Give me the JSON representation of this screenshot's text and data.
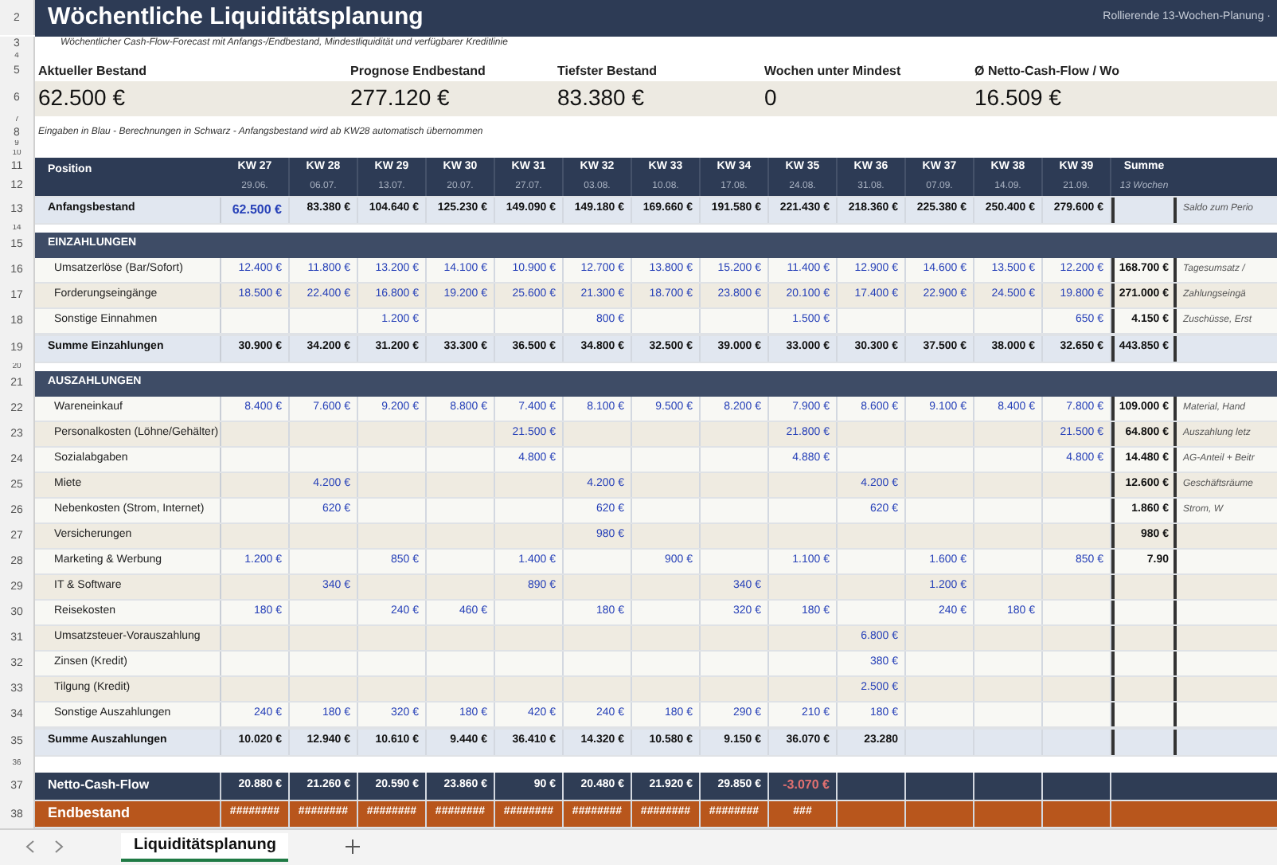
{
  "title": "Wöchentliche Liquiditätsplanung",
  "title_right": "Rollierende 13-Wochen-Planung ·",
  "top_row_numbers": [
    "2",
    "3",
    "4",
    "5",
    "6",
    "7",
    "8",
    "9",
    "10"
  ],
  "subtitle": "Wöchentlicher Cash-Flow-Forecast mit Anfangs-/Endbestand, Mindestliquidität und verfügbarer Kreditlinie",
  "kpis": [
    {
      "label": "Aktueller Bestand",
      "value": "62.500 €"
    },
    {
      "label": "Prognose Endbestand",
      "value": "277.120 €"
    },
    {
      "label": "Tiefster Bestand",
      "value": "83.380 €"
    },
    {
      "label": "Wochen unter Mindest",
      "value": "0"
    },
    {
      "label": "Ø Netto-Cash-Flow / Wo",
      "value": "16.509 €"
    }
  ],
  "note": "Eingaben in Blau - Berechnungen in Schwarz - Anfangsbestand wird ab KW28 automatisch übernommen",
  "header": {
    "nums": [
      "11",
      "12"
    ],
    "position": "Position",
    "summe": "Summe",
    "summe_sub": "13 Wochen",
    "weeks": [
      {
        "kw": "KW 27",
        "date": "29.06."
      },
      {
        "kw": "KW 28",
        "date": "06.07."
      },
      {
        "kw": "KW 29",
        "date": "13.07."
      },
      {
        "kw": "KW 30",
        "date": "20.07."
      },
      {
        "kw": "KW 31",
        "date": "27.07."
      },
      {
        "kw": "KW 32",
        "date": "03.08."
      },
      {
        "kw": "KW 33",
        "date": "10.08."
      },
      {
        "kw": "KW 34",
        "date": "17.08."
      },
      {
        "kw": "KW 35",
        "date": "24.08."
      },
      {
        "kw": "KW 36",
        "date": "31.08."
      },
      {
        "kw": "KW 37",
        "date": "07.09."
      },
      {
        "kw": "KW 38",
        "date": "14.09."
      },
      {
        "kw": "KW 39",
        "date": "21.09."
      }
    ]
  },
  "rows": [
    {
      "kind": "start",
      "num": "13",
      "label": "Anfangsbestand",
      "values": [
        {
          "text": "62.500 €",
          "color": "#2741b8"
        },
        "83.380 €",
        "104.640 €",
        "125.230 €",
        "149.090 €",
        "149.180 €",
        "169.660 €",
        "191.580 €",
        "221.430 €",
        "218.360 €",
        "225.380 €",
        "250.400 €",
        "279.600 €"
      ],
      "note": "Saldo zum Perio"
    },
    {
      "kind": "spacer",
      "num": "14"
    },
    {
      "kind": "section",
      "num": "15",
      "label": "EINZAHLUNGEN"
    },
    {
      "kind": "input",
      "num": "16",
      "label": "Umsatzerlöse (Bar/Sofort)",
      "values": [
        "12.400 €",
        "11.800 €",
        "13.200 €",
        "14.100 €",
        "10.900 €",
        "12.700 €",
        "13.800 €",
        "15.200 €",
        "11.400 €",
        "12.900 €",
        "14.600 €",
        "13.500 €",
        "12.200 €"
      ],
      "sum": "168.700 €",
      "note": "Tagesumsatz /"
    },
    {
      "kind": "input",
      "num": "17",
      "label": "Forderungseingänge",
      "values": [
        "18.500 €",
        "22.400 €",
        "16.800 €",
        "19.200 €",
        "25.600 €",
        "21.300 €",
        "18.700 €",
        "23.800 €",
        "20.100 €",
        "17.400 €",
        "22.900 €",
        "24.500 €",
        "19.800 €"
      ],
      "sum": "271.000 €",
      "note": "Zahlungseingä"
    },
    {
      "kind": "input",
      "num": "18",
      "label": "Sonstige Einnahmen",
      "values": [
        {
          "kind": "empty"
        },
        {
          "kind": "empty"
        },
        "1.200 €",
        {
          "kind": "empty"
        },
        {
          "kind": "empty"
        },
        "800 €",
        {
          "kind": "empty"
        },
        {
          "kind": "empty"
        },
        "1.500 €",
        {
          "kind": "empty"
        },
        {
          "kind": "empty"
        },
        {
          "kind": "empty"
        },
        "650 €"
      ],
      "sum": "4.150 €",
      "note": "Zuschüsse, Erst"
    },
    {
      "kind": "total",
      "num": "19",
      "label": "Summe Einzahlungen",
      "values": [
        "30.900 €",
        "34.200 €",
        "31.200 €",
        "33.300 €",
        "36.500 €",
        "34.800 €",
        "32.500 €",
        "39.000 €",
        "33.000 €",
        "30.300 €",
        "37.500 €",
        "38.000 €",
        "32.650 €"
      ],
      "sum": "443.850 €"
    },
    {
      "kind": "spacer",
      "num": "20"
    },
    {
      "kind": "section",
      "num": "21",
      "label": "AUSZAHLUNGEN"
    },
    {
      "kind": "input",
      "num": "22",
      "label": "Wareneinkauf",
      "values": [
        "8.400 €",
        "7.600 €",
        "9.200 €",
        "8.800 €",
        "7.400 €",
        "8.100 €",
        "9.500 €",
        "8.200 €",
        "7.900 €",
        "8.600 €",
        "9.100 €",
        "8.400 €",
        "7.800 €"
      ],
      "sum": "109.000 €",
      "note": "Material, Hand"
    },
    {
      "kind": "input",
      "num": "23",
      "label": "Personalkosten (Löhne/Gehälter)",
      "values": [
        {
          "kind": "empty"
        },
        {
          "kind": "empty"
        },
        {
          "kind": "empty"
        },
        {
          "kind": "empty"
        },
        "21.500 €",
        {
          "kind": "empty"
        },
        {
          "kind": "empty"
        },
        {
          "kind": "empty"
        },
        "21.800 €",
        {
          "kind": "empty"
        },
        {
          "kind": "empty"
        },
        {
          "kind": "empty"
        },
        "21.500 €"
      ],
      "sum": "64.800 €",
      "note": "Auszahlung letz"
    },
    {
      "kind": "input",
      "num": "24",
      "label": "Sozialabgaben",
      "values": [
        {
          "kind": "empty"
        },
        {
          "kind": "empty"
        },
        {
          "kind": "empty"
        },
        {
          "kind": "empty"
        },
        "4.800 €",
        {
          "kind": "empty"
        },
        {
          "kind": "empty"
        },
        {
          "kind": "empty"
        },
        "4.880 €",
        {
          "kind": "empty"
        },
        {
          "kind": "empty"
        },
        {
          "kind": "empty"
        },
        "4.800 €"
      ],
      "sum": "14.480 €",
      "note": "AG-Anteil + Beitr"
    },
    {
      "kind": "input",
      "num": "25",
      "label": "Miete",
      "values": [
        {
          "kind": "empty"
        },
        "4.200 €",
        {
          "kind": "empty"
        },
        {
          "kind": "empty"
        },
        {
          "kind": "empty"
        },
        "4.200 €",
        {
          "kind": "empty"
        },
        {
          "kind": "empty"
        },
        {
          "kind": "empty"
        },
        "4.200 €",
        {
          "kind": "empty"
        },
        {
          "kind": "empty"
        },
        {
          "kind": "empty"
        }
      ],
      "sum": "12.600 €",
      "note": "Geschäftsräume"
    },
    {
      "kind": "input",
      "num": "26",
      "label": "Nebenkosten (Strom, Internet)",
      "values": [
        {
          "kind": "empty"
        },
        "620 €",
        {
          "kind": "empty"
        },
        {
          "kind": "empty"
        },
        {
          "kind": "empty"
        },
        "620 €",
        {
          "kind": "empty"
        },
        {
          "kind": "empty"
        },
        {
          "kind": "empty"
        },
        "620 €",
        {
          "kind": "empty"
        },
        {
          "kind": "empty"
        },
        {
          "kind": "empty"
        }
      ],
      "sum": "1.860 €",
      "note": "Strom, W"
    },
    {
      "kind": "input",
      "num": "27",
      "label": "Versicherungen",
      "values": [
        {
          "kind": "empty"
        },
        {
          "kind": "empty"
        },
        {
          "kind": "empty"
        },
        {
          "kind": "empty"
        },
        {
          "kind": "empty"
        },
        "980 €",
        {
          "kind": "empty"
        },
        {
          "kind": "empty"
        },
        {
          "kind": "empty"
        },
        {
          "kind": "empty"
        },
        {
          "kind": "empty"
        },
        {
          "kind": "empty"
        },
        {
          "kind": "empty"
        }
      ],
      "sum": "980 €"
    },
    {
      "kind": "input",
      "num": "28",
      "label": "Marketing & Werbung",
      "values": [
        "1.200 €",
        {
          "kind": "empty"
        },
        "850 €",
        {
          "kind": "empty"
        },
        "1.400 €",
        {
          "kind": "empty"
        },
        "900 €",
        {
          "kind": "empty"
        },
        "1.100 €",
        {
          "kind": "empty"
        },
        "1.600 €",
        {
          "kind": "empty"
        },
        "850 €"
      ],
      "sum": "7.90"
    },
    {
      "kind": "input",
      "num": "29",
      "label": "IT & Software",
      "values": [
        {
          "kind": "empty"
        },
        "340 €",
        {
          "kind": "empty"
        },
        {
          "kind": "empty"
        },
        "890 €",
        {
          "kind": "empty"
        },
        {
          "kind": "empty"
        },
        "340 €",
        {
          "kind": "empty"
        },
        {
          "kind": "empty"
        },
        "1.200 €",
        {
          "kind": "empty"
        },
        {
          "kind": "empty"
        }
      ]
    },
    {
      "kind": "input",
      "num": "30",
      "label": "Reisekosten",
      "values": [
        "180 €",
        {
          "kind": "empty"
        },
        "240 €",
        "460 €",
        {
          "kind": "empty"
        },
        "180 €",
        {
          "kind": "empty"
        },
        "320 €",
        "180 €",
        {
          "kind": "empty"
        },
        "240 €",
        "180 €",
        {
          "kind": "empty"
        }
      ]
    },
    {
      "kind": "input",
      "num": "31",
      "label": "Umsatzsteuer-Vorauszahlung",
      "values": [
        {
          "kind": "empty"
        },
        {
          "kind": "empty"
        },
        {
          "kind": "empty"
        },
        {
          "kind": "empty"
        },
        {
          "kind": "empty"
        },
        {
          "kind": "empty"
        },
        {
          "kind": "empty"
        },
        {
          "kind": "empty"
        },
        {
          "kind": "empty"
        },
        "6.800 €",
        {
          "kind": "empty"
        },
        {
          "kind": "empty"
        },
        {
          "kind": "empty"
        }
      ]
    },
    {
      "kind": "input",
      "num": "32",
      "label": "Zinsen (Kredit)",
      "values": [
        {
          "kind": "empty"
        },
        {
          "kind": "empty"
        },
        {
          "kind": "empty"
        },
        {
          "kind": "empty"
        },
        {
          "kind": "empty"
        },
        {
          "kind": "empty"
        },
        {
          "kind": "empty"
        },
        {
          "kind": "empty"
        },
        {
          "kind": "empty"
        },
        "380 €",
        {
          "kind": "empty"
        },
        {
          "kind": "empty"
        },
        {
          "kind": "empty"
        }
      ]
    },
    {
      "kind": "input",
      "num": "33",
      "label": "Tilgung (Kredit)",
      "values": [
        {
          "kind": "empty"
        },
        {
          "kind": "empty"
        },
        {
          "kind": "empty"
        },
        {
          "kind": "empty"
        },
        {
          "kind": "empty"
        },
        {
          "kind": "empty"
        },
        {
          "kind": "empty"
        },
        {
          "kind": "empty"
        },
        {
          "kind": "empty"
        },
        "2.500 €",
        {
          "kind": "empty"
        },
        {
          "kind": "empty"
        },
        {
          "kind": "empty"
        }
      ]
    },
    {
      "kind": "input",
      "num": "34",
      "label": "Sonstige Auszahlungen",
      "values": [
        "240 €",
        "180 €",
        "320 €",
        "180 €",
        "420 €",
        "240 €",
        "180 €",
        "290 €",
        "210 €",
        "180 €",
        {
          "kind": "empty"
        },
        {
          "kind": "empty"
        },
        {
          "kind": "empty"
        }
      ]
    },
    {
      "kind": "total",
      "num": "35",
      "label": "Summe Auszahlungen",
      "values": [
        "10.020 €",
        "12.940 €",
        "10.610 €",
        "9.440 €",
        "36.410 €",
        "14.320 €",
        "10.580 €",
        "9.150 €",
        "36.070 €",
        "23.280",
        {
          "kind": "empty"
        },
        {
          "kind": "empty"
        },
        {
          "kind": "empty"
        }
      ]
    },
    {
      "kind": "spacer",
      "num": "36"
    },
    {
      "kind": "net",
      "num": "37",
      "label": "Netto-Cash-Flow",
      "values": [
        "20.880 €",
        "21.260 €",
        "20.590 €",
        "23.860 €",
        "90 €",
        "20.480 €",
        "21.920 €",
        "29.850 €",
        {
          "text": "-3.070 €",
          "color": "#e07070"
        },
        {
          "kind": "empty"
        },
        {
          "kind": "empty"
        },
        {
          "kind": "empty"
        },
        {
          "kind": "empty"
        }
      ]
    },
    {
      "kind": "end",
      "num": "38",
      "label": "Endbestand",
      "values": [
        "########",
        "########",
        "########",
        "########",
        "########",
        "########",
        "########",
        "########",
        "###",
        {
          "kind": "empty"
        },
        {
          "kind": "empty"
        },
        {
          "kind": "empty"
        },
        {
          "kind": "empty"
        }
      ]
    }
  ],
  "sheet_tabs": [
    {
      "label": "Liquiditätsplanung",
      "selected": true
    }
  ]
}
